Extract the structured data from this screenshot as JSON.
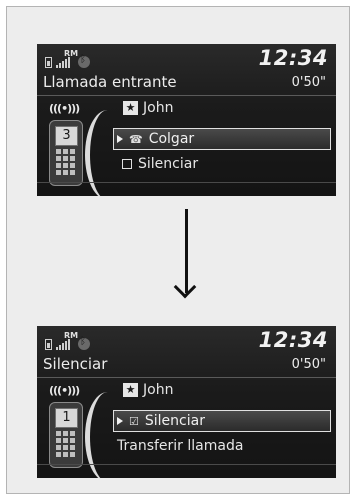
{
  "screens": [
    {
      "status": {
        "rm_label": "RM",
        "signal_icon": "signal-icon",
        "battery_icon": "battery-icon",
        "bluetooth_icon": "bluetooth-icon"
      },
      "time": "12:34",
      "title": "Llamada entrante",
      "duration": "0'50\"",
      "contact": "John",
      "phone_screen_digit": "3",
      "selected_item": "Colgar",
      "selected_icon": "handset-icon",
      "other_item": "Silenciar"
    },
    {
      "status": {
        "rm_label": "RM",
        "signal_icon": "signal-icon",
        "battery_icon": "battery-icon",
        "bluetooth_icon": "bluetooth-icon"
      },
      "time": "12:34",
      "title": "Silenciar",
      "duration": "0'50\"",
      "contact": "John",
      "phone_screen_digit": "1",
      "selected_item": "Silenciar",
      "selected_icon": "checkbox-checked-icon",
      "other_item": "Transferir llamada"
    }
  ],
  "waves_label": "(((•)))",
  "colors": {
    "screen_bg": "#1b1b1b",
    "text": "#e6e6e6",
    "frame_bg": "#ededed"
  }
}
